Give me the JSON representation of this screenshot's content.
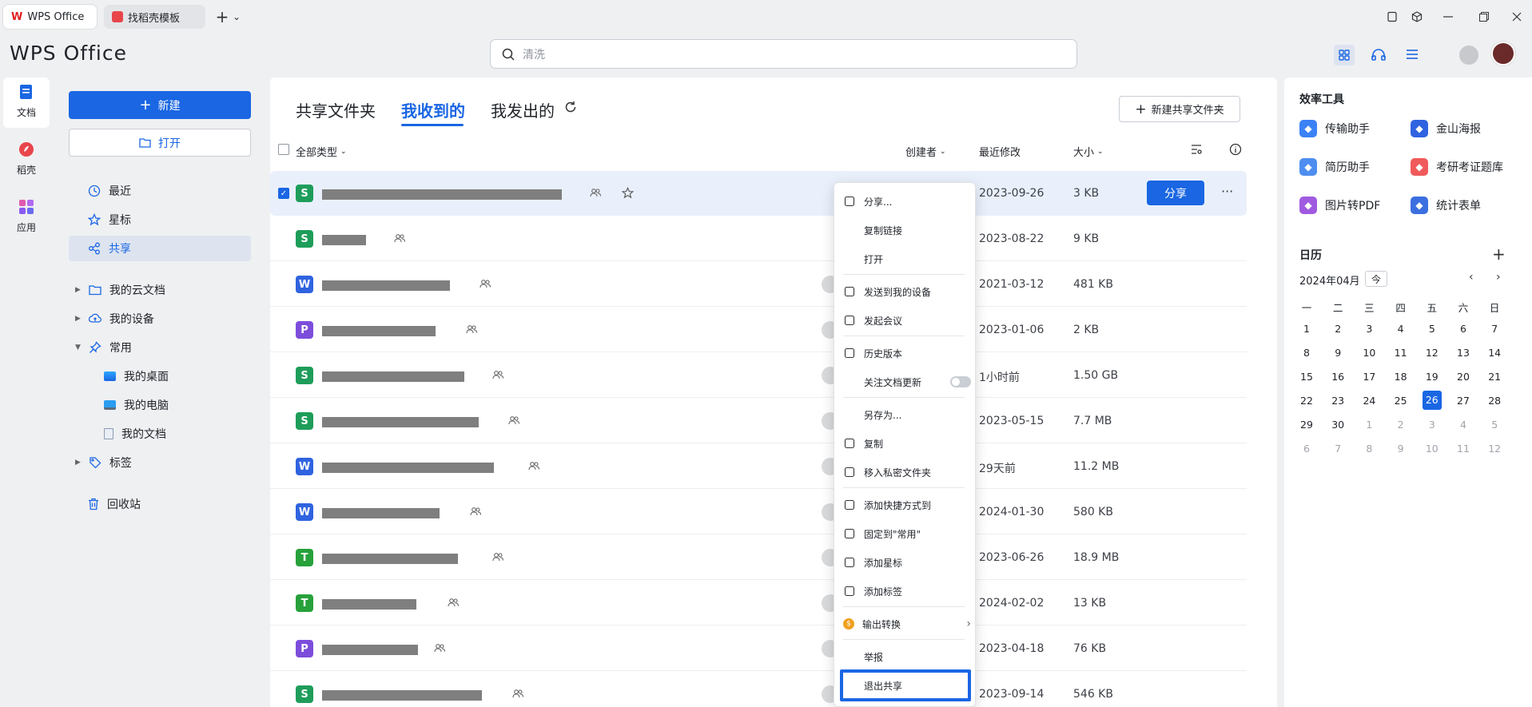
{
  "titlebar": {
    "tabs": [
      {
        "label": "WPS Office",
        "icon": "wps-logo-icon"
      },
      {
        "label": "找稻壳模板",
        "icon": "docer-icon"
      }
    ],
    "new_tab": "+",
    "tab_menu": "⌄"
  },
  "header": {
    "logo": "WPS Office",
    "search_value": "清洗"
  },
  "rail": [
    {
      "label": "文档",
      "icon": "document-icon"
    },
    {
      "label": "稻壳",
      "icon": "docer-icon"
    },
    {
      "label": "应用",
      "icon": "apps-icon"
    }
  ],
  "sidebar": {
    "new_label": "新建",
    "open_label": "打开",
    "nav": [
      {
        "label": "最近",
        "icon": "clock-icon"
      },
      {
        "label": "星标",
        "icon": "star-icon"
      },
      {
        "label": "共享",
        "icon": "share-icon"
      },
      {
        "label": "我的云文档",
        "icon": "folder-icon"
      },
      {
        "label": "我的设备",
        "icon": "cloud-device-icon"
      },
      {
        "label": "常用",
        "icon": "pin-icon"
      },
      {
        "label": "我的桌面",
        "icon": "desktop-icon"
      },
      {
        "label": "我的电脑",
        "icon": "computer-icon"
      },
      {
        "label": "我的文档",
        "icon": "mydocs-icon"
      },
      {
        "label": "标签",
        "icon": "tag-icon"
      },
      {
        "label": "回收站",
        "icon": "trash-icon"
      }
    ]
  },
  "main": {
    "tabs": [
      "共享文件夹",
      "我收到的",
      "我发出的"
    ],
    "selected_tab": "我收到的",
    "new_shared_folder": "新建共享文件夹",
    "columns": {
      "type": "全部类型",
      "creator": "创建者",
      "modified": "最近修改",
      "size": "大小"
    },
    "share_button": "分享",
    "more": "···",
    "rows": [
      {
        "type": "S",
        "color": "#1e9d5a",
        "date": "2023-09-26",
        "size": "3 KB",
        "selected": true
      },
      {
        "type": "S",
        "color": "#1e9d5a",
        "date": "2023-08-22",
        "size": "9 KB"
      },
      {
        "type": "W",
        "color": "#2f63e0",
        "date": "2021-03-12",
        "size": "481 KB"
      },
      {
        "type": "P",
        "color": "#7c4ddb",
        "date": "2023-01-06",
        "size": "2 KB"
      },
      {
        "type": "S",
        "color": "#1e9d5a",
        "date": "1小时前",
        "size": "1.50 GB"
      },
      {
        "type": "S",
        "color": "#1e9d5a",
        "date": "2023-05-15",
        "size": "7.7 MB"
      },
      {
        "type": "W",
        "color": "#2f63e0",
        "date": "29天前",
        "size": "11.2 MB"
      },
      {
        "type": "W",
        "color": "#2f63e0",
        "date": "2024-01-30",
        "size": "580 KB"
      },
      {
        "type": "T",
        "color": "#27a13a",
        "date": "2023-06-26",
        "size": "18.9 MB"
      },
      {
        "type": "T",
        "color": "#27a13a",
        "date": "2024-02-02",
        "size": "13 KB"
      },
      {
        "type": "P",
        "color": "#7c4ddb",
        "date": "2023-04-18",
        "size": "76 KB"
      },
      {
        "type": "S",
        "color": "#1e9d5a",
        "date": "2023-09-14",
        "size": "546 KB"
      }
    ]
  },
  "context_menu": {
    "items": [
      {
        "label": "分享...",
        "icon": "share-out-icon"
      },
      {
        "label": "复制链接",
        "icon": ""
      },
      {
        "label": "打开",
        "icon": ""
      },
      {
        "label": "发送到我的设备",
        "icon": "send-device-icon"
      },
      {
        "label": "发起会议",
        "icon": "meeting-icon"
      },
      {
        "label": "历史版本",
        "icon": "history-icon"
      },
      {
        "label": "关注文档更新",
        "icon": ""
      },
      {
        "label": "另存为...",
        "icon": ""
      },
      {
        "label": "复制",
        "icon": "copy-icon"
      },
      {
        "label": "移入私密文件夹",
        "icon": "private-folder-icon"
      },
      {
        "label": "添加快捷方式到",
        "icon": "shortcut-icon"
      },
      {
        "label": "固定到\"常用\"",
        "icon": "pin-icon"
      },
      {
        "label": "添加星标",
        "icon": "star-icon"
      },
      {
        "label": "添加标签",
        "icon": "tag-icon"
      },
      {
        "label": "输出转换",
        "icon": "convert-icon"
      },
      {
        "label": "举报",
        "icon": ""
      },
      {
        "label": "退出共享",
        "icon": ""
      }
    ]
  },
  "right_panel": {
    "tools_title": "效率工具",
    "tools": [
      {
        "label": "传输助手",
        "color": "#3b82f6"
      },
      {
        "label": "金山海报",
        "color": "#2f63e0"
      },
      {
        "label": "简历助手",
        "color": "#4d8ef0"
      },
      {
        "label": "考研考证题库",
        "color": "#f05a5a"
      },
      {
        "label": "图片转PDF",
        "color": "#a05ae0"
      },
      {
        "label": "统计表单",
        "color": "#3b6fe0"
      }
    ],
    "calendar_title": "日历",
    "month": "2024年04月",
    "today_btn": "今",
    "weekdays": [
      "一",
      "二",
      "三",
      "四",
      "五",
      "六",
      "日"
    ],
    "days": [
      "1",
      "2",
      "3",
      "4",
      "5",
      "6",
      "7",
      "8",
      "9",
      "10",
      "11",
      "12",
      "13",
      "14",
      "15",
      "16",
      "17",
      "18",
      "19",
      "20",
      "21",
      "22",
      "23",
      "24",
      "25",
      "26",
      "27",
      "28",
      "29",
      "30",
      "1",
      "2",
      "3",
      "4",
      "5",
      "6",
      "7",
      "8",
      "9",
      "10",
      "11",
      "12"
    ],
    "selected_day": "26"
  }
}
